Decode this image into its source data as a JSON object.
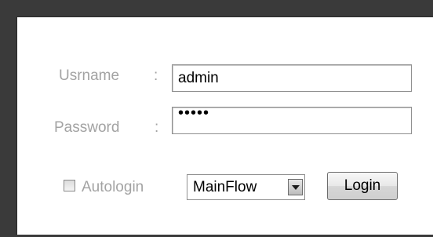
{
  "login_form": {
    "username_label": "Usrname",
    "password_label": "Password",
    "colon": ":",
    "username_value": "admin",
    "password_mask": "•••••",
    "autologin_label": "Autologin",
    "autologin_checked": false,
    "flow_selected": "MainFlow",
    "login_button": "Login"
  },
  "icons": {
    "dropdown": "chevron-down-icon",
    "checkbox": "checkbox-unchecked-icon"
  },
  "colors": {
    "frame": "#3a3a3a",
    "panel": "#ffffff",
    "label": "#a3a3a3"
  }
}
